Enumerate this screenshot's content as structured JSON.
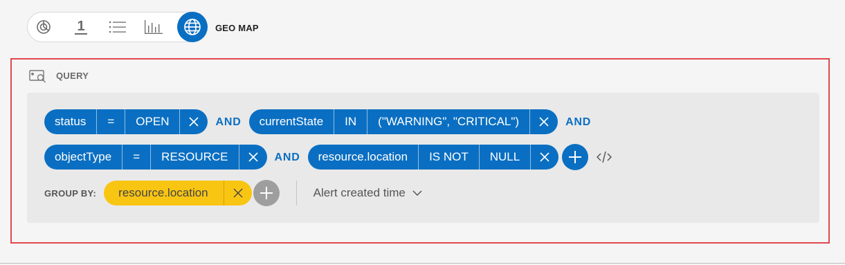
{
  "viz_toolbar": {
    "options": [
      {
        "icon": "pie-chart-icon"
      },
      {
        "icon": "single-number-icon",
        "text": "1"
      },
      {
        "icon": "list-icon"
      },
      {
        "icon": "bar-chart-icon"
      },
      {
        "icon": "globe-icon",
        "selected": true
      }
    ],
    "selected_label": "GEO MAP"
  },
  "query": {
    "label": "QUERY",
    "icon": "query-search-icon",
    "conditions": [
      {
        "field": "status",
        "operator": "=",
        "value": "OPEN"
      },
      {
        "field": "currentState",
        "operator": "IN",
        "value": "(\"WARNING\", \"CRITICAL\")"
      },
      {
        "field": "objectType",
        "operator": "=",
        "value": "RESOURCE"
      },
      {
        "field": "resource.location",
        "operator": "IS NOT",
        "value": "NULL"
      }
    ],
    "conjunction": "AND",
    "group_by": {
      "label": "GROUP BY:",
      "value": "resource.location"
    },
    "time_field": "Alert created time"
  },
  "colors": {
    "accent": "#0a6fc2",
    "group_chip": "#f9c513",
    "highlight_border": "#e0474c"
  }
}
